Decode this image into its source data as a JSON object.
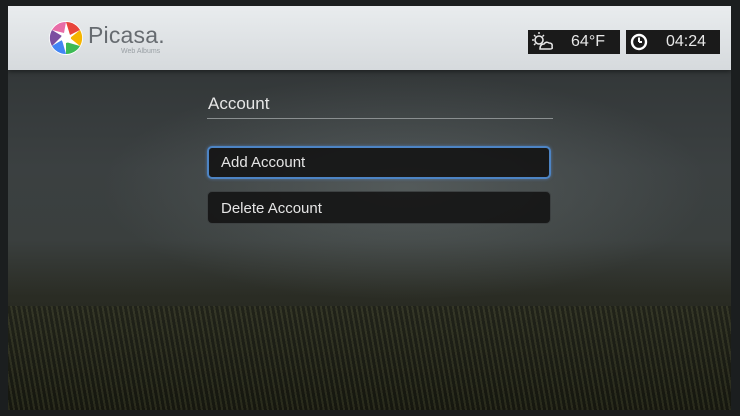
{
  "header": {
    "logo_text": "Picasa.",
    "logo_subtitle": "Web Albums",
    "weather": {
      "icon": "weather-icon",
      "temperature": "64°F"
    },
    "clock": {
      "icon": "clock-icon",
      "time": "04:24"
    }
  },
  "main": {
    "title": "Account",
    "menu": [
      {
        "label": "Add Account",
        "selected": true
      },
      {
        "label": "Delete Account",
        "selected": false
      }
    ]
  },
  "colors": {
    "selection_border": "#4d84c4",
    "header_bg": "#e2e5e8"
  }
}
